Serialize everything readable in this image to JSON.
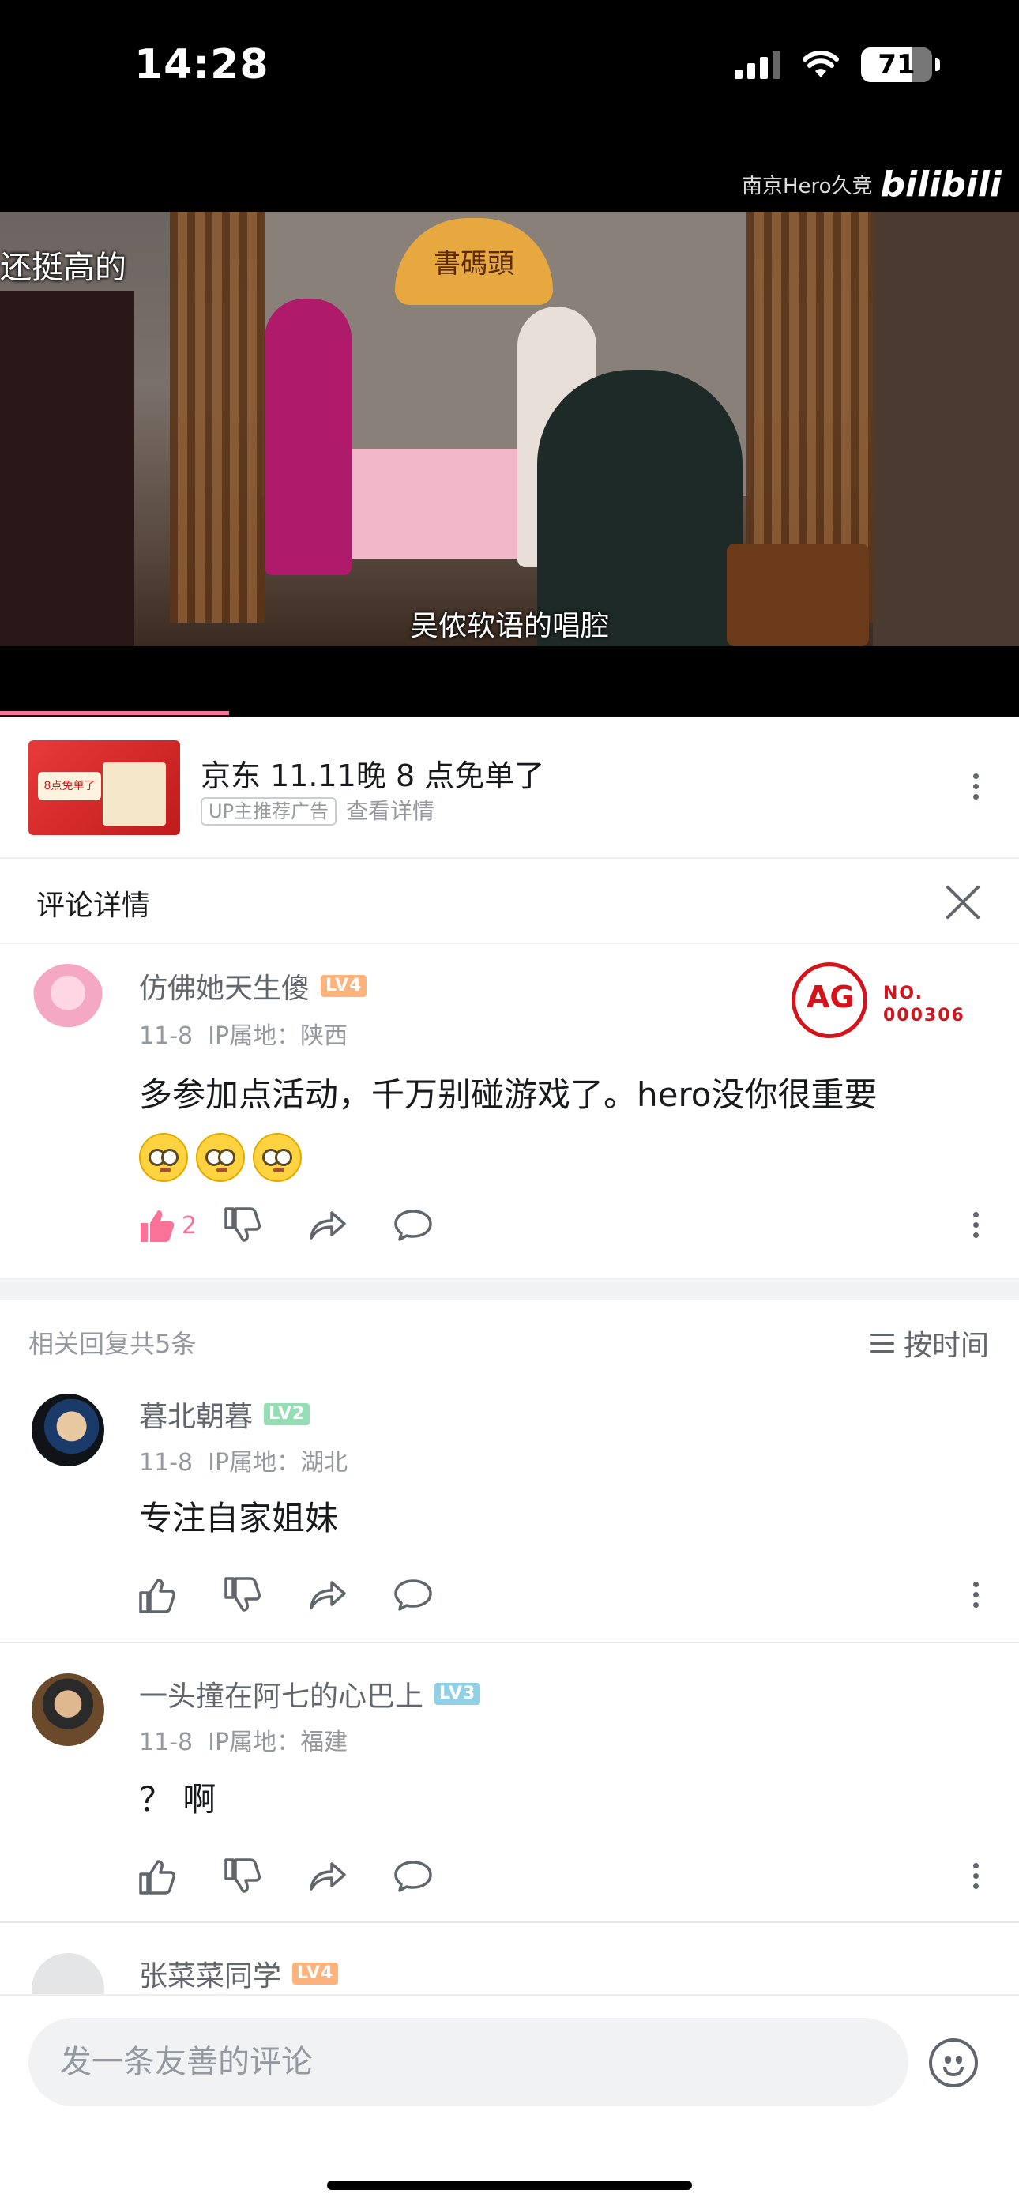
{
  "status_bar": {
    "time": "14:28",
    "battery": "71"
  },
  "video": {
    "watermark_text": "南京Hero久竞",
    "watermark_logo": "bilibili",
    "sign_text": "書碼頭",
    "subtitle_top": "还挺高的",
    "subtitle_bottom": "吴侬软语的唱腔",
    "progress_fraction": 0.225,
    "accent_color": "#fb7299"
  },
  "ad": {
    "thumb_text": "8点免单了",
    "title": "京东 11.11晚 8 点免单了",
    "tag": "UP主推荐广告",
    "detail": "查看详情"
  },
  "comment_detail": {
    "title": "评论详情"
  },
  "main_comment": {
    "username": "仿佛她天生傻",
    "level": "LV4",
    "date": "11-8",
    "ip": "IP属地：陕西",
    "text": "多参加点活动，千万别碰游戏了。hero没你很重要",
    "emojis": [
      "dizzy-eyes",
      "dizzy-eyes",
      "dizzy-eyes"
    ],
    "likes": "2",
    "badge": {
      "logo": "AG",
      "label": "NO.",
      "number": "000306"
    }
  },
  "replies_header": {
    "count_text": "相关回复共5条",
    "sort_label": "按时间"
  },
  "replies": [
    {
      "username": "暮北朝暮",
      "level": "LV2",
      "date": "11-8",
      "ip": "IP属地：湖北",
      "text": "专注自家姐妹"
    },
    {
      "username": "一头撞在阿七的心巴上",
      "level": "LV3",
      "date": "11-8",
      "ip": "IP属地：福建",
      "text": "？ 啊"
    },
    {
      "username": "张菜菜同学",
      "level": "LV4"
    }
  ],
  "input_bar": {
    "placeholder": "发一条友善的评论"
  }
}
